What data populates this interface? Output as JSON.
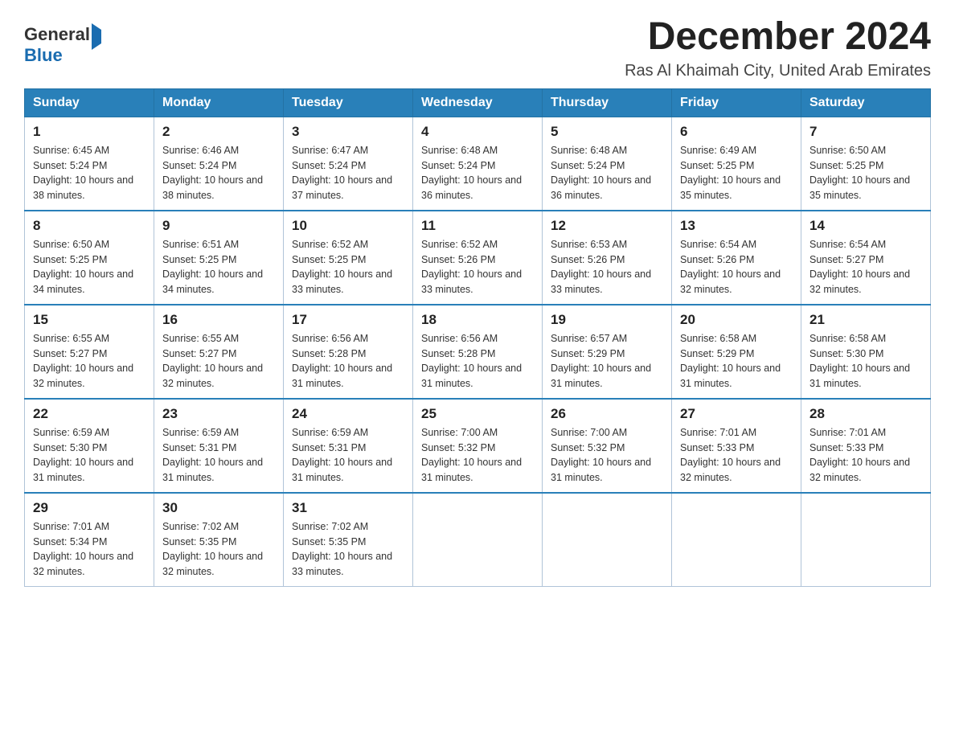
{
  "logo": {
    "general": "General",
    "blue": "Blue"
  },
  "title": "December 2024",
  "location": "Ras Al Khaimah City, United Arab Emirates",
  "headers": [
    "Sunday",
    "Monday",
    "Tuesday",
    "Wednesday",
    "Thursday",
    "Friday",
    "Saturday"
  ],
  "weeks": [
    [
      {
        "day": "1",
        "sunrise": "6:45 AM",
        "sunset": "5:24 PM",
        "daylight": "10 hours and 38 minutes."
      },
      {
        "day": "2",
        "sunrise": "6:46 AM",
        "sunset": "5:24 PM",
        "daylight": "10 hours and 38 minutes."
      },
      {
        "day": "3",
        "sunrise": "6:47 AM",
        "sunset": "5:24 PM",
        "daylight": "10 hours and 37 minutes."
      },
      {
        "day": "4",
        "sunrise": "6:48 AM",
        "sunset": "5:24 PM",
        "daylight": "10 hours and 36 minutes."
      },
      {
        "day": "5",
        "sunrise": "6:48 AM",
        "sunset": "5:24 PM",
        "daylight": "10 hours and 36 minutes."
      },
      {
        "day": "6",
        "sunrise": "6:49 AM",
        "sunset": "5:25 PM",
        "daylight": "10 hours and 35 minutes."
      },
      {
        "day": "7",
        "sunrise": "6:50 AM",
        "sunset": "5:25 PM",
        "daylight": "10 hours and 35 minutes."
      }
    ],
    [
      {
        "day": "8",
        "sunrise": "6:50 AM",
        "sunset": "5:25 PM",
        "daylight": "10 hours and 34 minutes."
      },
      {
        "day": "9",
        "sunrise": "6:51 AM",
        "sunset": "5:25 PM",
        "daylight": "10 hours and 34 minutes."
      },
      {
        "day": "10",
        "sunrise": "6:52 AM",
        "sunset": "5:25 PM",
        "daylight": "10 hours and 33 minutes."
      },
      {
        "day": "11",
        "sunrise": "6:52 AM",
        "sunset": "5:26 PM",
        "daylight": "10 hours and 33 minutes."
      },
      {
        "day": "12",
        "sunrise": "6:53 AM",
        "sunset": "5:26 PM",
        "daylight": "10 hours and 33 minutes."
      },
      {
        "day": "13",
        "sunrise": "6:54 AM",
        "sunset": "5:26 PM",
        "daylight": "10 hours and 32 minutes."
      },
      {
        "day": "14",
        "sunrise": "6:54 AM",
        "sunset": "5:27 PM",
        "daylight": "10 hours and 32 minutes."
      }
    ],
    [
      {
        "day": "15",
        "sunrise": "6:55 AM",
        "sunset": "5:27 PM",
        "daylight": "10 hours and 32 minutes."
      },
      {
        "day": "16",
        "sunrise": "6:55 AM",
        "sunset": "5:27 PM",
        "daylight": "10 hours and 32 minutes."
      },
      {
        "day": "17",
        "sunrise": "6:56 AM",
        "sunset": "5:28 PM",
        "daylight": "10 hours and 31 minutes."
      },
      {
        "day": "18",
        "sunrise": "6:56 AM",
        "sunset": "5:28 PM",
        "daylight": "10 hours and 31 minutes."
      },
      {
        "day": "19",
        "sunrise": "6:57 AM",
        "sunset": "5:29 PM",
        "daylight": "10 hours and 31 minutes."
      },
      {
        "day": "20",
        "sunrise": "6:58 AM",
        "sunset": "5:29 PM",
        "daylight": "10 hours and 31 minutes."
      },
      {
        "day": "21",
        "sunrise": "6:58 AM",
        "sunset": "5:30 PM",
        "daylight": "10 hours and 31 minutes."
      }
    ],
    [
      {
        "day": "22",
        "sunrise": "6:59 AM",
        "sunset": "5:30 PM",
        "daylight": "10 hours and 31 minutes."
      },
      {
        "day": "23",
        "sunrise": "6:59 AM",
        "sunset": "5:31 PM",
        "daylight": "10 hours and 31 minutes."
      },
      {
        "day": "24",
        "sunrise": "6:59 AM",
        "sunset": "5:31 PM",
        "daylight": "10 hours and 31 minutes."
      },
      {
        "day": "25",
        "sunrise": "7:00 AM",
        "sunset": "5:32 PM",
        "daylight": "10 hours and 31 minutes."
      },
      {
        "day": "26",
        "sunrise": "7:00 AM",
        "sunset": "5:32 PM",
        "daylight": "10 hours and 31 minutes."
      },
      {
        "day": "27",
        "sunrise": "7:01 AM",
        "sunset": "5:33 PM",
        "daylight": "10 hours and 32 minutes."
      },
      {
        "day": "28",
        "sunrise": "7:01 AM",
        "sunset": "5:33 PM",
        "daylight": "10 hours and 32 minutes."
      }
    ],
    [
      {
        "day": "29",
        "sunrise": "7:01 AM",
        "sunset": "5:34 PM",
        "daylight": "10 hours and 32 minutes."
      },
      {
        "day": "30",
        "sunrise": "7:02 AM",
        "sunset": "5:35 PM",
        "daylight": "10 hours and 32 minutes."
      },
      {
        "day": "31",
        "sunrise": "7:02 AM",
        "sunset": "5:35 PM",
        "daylight": "10 hours and 33 minutes."
      },
      null,
      null,
      null,
      null
    ]
  ],
  "labels": {
    "sunrise_prefix": "Sunrise: ",
    "sunset_prefix": "Sunset: ",
    "daylight_prefix": "Daylight: "
  }
}
